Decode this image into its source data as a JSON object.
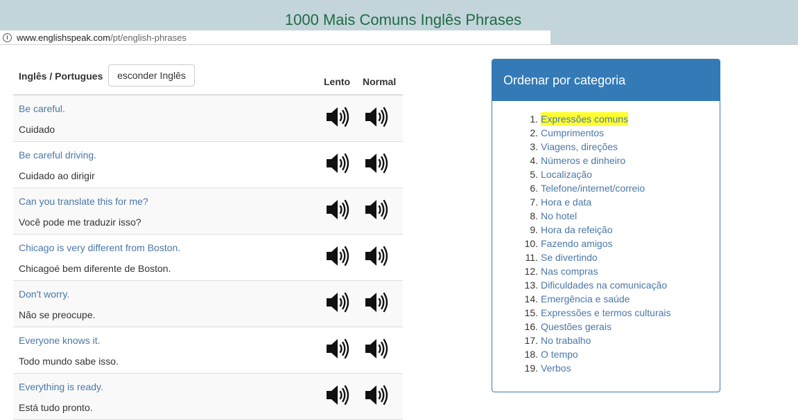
{
  "page": {
    "title": "1000 Mais Comuns Inglês Phrases",
    "url_host": "www.englishspeak.com",
    "url_path": "/pt/english-phrases"
  },
  "table": {
    "header_langs": "Inglês / Portugues",
    "toggle_label": "esconder Inglês",
    "col_slow": "Lento",
    "col_normal": "Normal",
    "speaker_icon": "speaker-volume-icon",
    "rows": [
      {
        "en": "Be careful.",
        "pt": "Cuidado"
      },
      {
        "en": "Be careful driving.",
        "pt": "Cuidado ao dirigir"
      },
      {
        "en": "Can you translate this for me?",
        "pt": "Você pode me traduzir isso?"
      },
      {
        "en": "Chicago is very different from Boston.",
        "pt": "Chicagoé bem diferente de Boston."
      },
      {
        "en": "Don't worry.",
        "pt": "Não se preocupe."
      },
      {
        "en": "Everyone knows it.",
        "pt": "Todo mundo sabe isso."
      },
      {
        "en": "Everything is ready.",
        "pt": "Está tudo pronto."
      }
    ]
  },
  "categories": {
    "title": "Ordenar por categoria",
    "items": [
      {
        "num": "1.",
        "label": "Expressões comuns",
        "active": true
      },
      {
        "num": "2.",
        "label": "Cumprimentos"
      },
      {
        "num": "3.",
        "label": "Viagens, direções"
      },
      {
        "num": "4.",
        "label": "Números e dinheiro"
      },
      {
        "num": "5.",
        "label": "Localização"
      },
      {
        "num": "6.",
        "label": "Telefone/internet/correio"
      },
      {
        "num": "7.",
        "label": "Hora e data"
      },
      {
        "num": "8.",
        "label": "No hotel"
      },
      {
        "num": "9.",
        "label": "Hora da refeição"
      },
      {
        "num": "10.",
        "label": "Fazendo amigos"
      },
      {
        "num": "11.",
        "label": "Se divertindo"
      },
      {
        "num": "12.",
        "label": "Nas compras"
      },
      {
        "num": "13.",
        "label": "Dificuldades na comunicação"
      },
      {
        "num": "14.",
        "label": "Emergência e saúde"
      },
      {
        "num": "15.",
        "label": "Expressões e termos culturais"
      },
      {
        "num": "16.",
        "label": "Questões gerais"
      },
      {
        "num": "17.",
        "label": "No trabalho"
      },
      {
        "num": "18.",
        "label": "O tempo"
      },
      {
        "num": "19.",
        "label": "Verbos"
      }
    ]
  },
  "colors": {
    "title_green": "#1f6b45",
    "link_blue": "#4a77a8",
    "panel_blue": "#337ab7",
    "highlight_yellow": "#ffff33",
    "header_bg": "#c3d5da"
  }
}
